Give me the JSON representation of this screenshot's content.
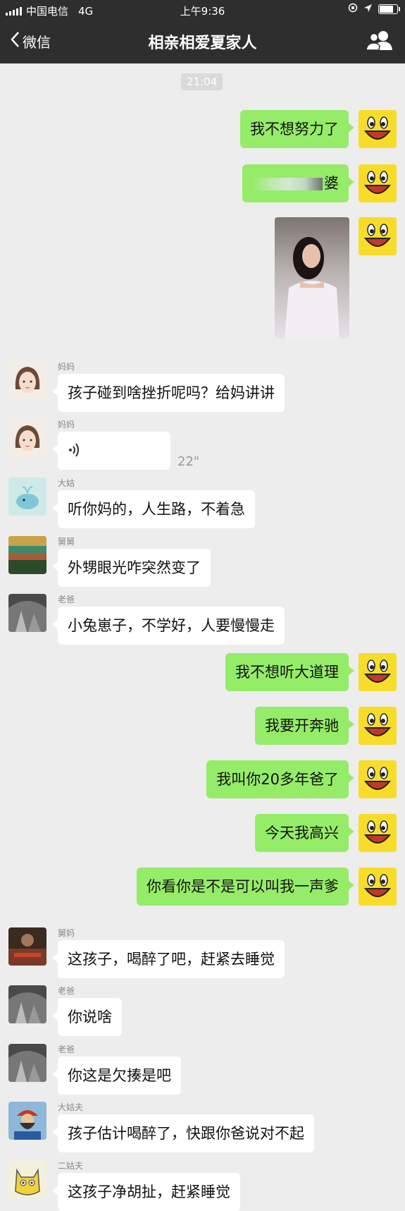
{
  "status": {
    "carrier": "中国电信",
    "network": "4G",
    "time": "上午9:36",
    "battery_level": 0.85
  },
  "nav": {
    "back_label": "微信",
    "title": "相亲相爱夏家人"
  },
  "chat": {
    "timestamp": "21:04",
    "messages": [
      {
        "side": "me",
        "text": "我不想努力了"
      },
      {
        "side": "me",
        "text": "婆"
      },
      {
        "side": "them",
        "sender": "妈妈",
        "text": "孩子碰到啥挫折呢吗？给妈讲讲"
      },
      {
        "side": "them",
        "sender": "妈妈",
        "voice_duration": "22\""
      },
      {
        "side": "them",
        "sender": "大姑",
        "text": "听你妈的，人生路，不着急"
      },
      {
        "side": "them",
        "sender": "舅舅",
        "text": "外甥眼光咋突然变了"
      },
      {
        "side": "them",
        "sender": "老爸",
        "text": "小兔崽子，不学好，人要慢慢走"
      },
      {
        "side": "me",
        "text": "我不想听大道理"
      },
      {
        "side": "me",
        "text": "我要开奔驰"
      },
      {
        "side": "me",
        "text": "我叫你20多年爸了"
      },
      {
        "side": "me",
        "text": "今天我高兴"
      },
      {
        "side": "me",
        "text": "你看你是不是可以叫我一声爹"
      },
      {
        "side": "them",
        "sender": "舅妈",
        "text": "这孩子，喝醉了吧，赶紧去睡觉"
      },
      {
        "side": "them",
        "sender": "老爸",
        "text": "你说啥"
      },
      {
        "side": "them",
        "sender": "老爸",
        "text": "你这是欠揍是吧"
      },
      {
        "side": "them",
        "sender": "大姑夫",
        "text": "孩子估计喝醉了，快跟你爸说对不起"
      },
      {
        "side": "them",
        "sender": "二姑夫",
        "text": "这孩子净胡扯，赶紧睡觉"
      }
    ]
  },
  "colors": {
    "my_bubble": "#95ec69",
    "their_bubble": "#ffffff",
    "background": "#ededed",
    "nav_bar": "#2e2e2e"
  }
}
